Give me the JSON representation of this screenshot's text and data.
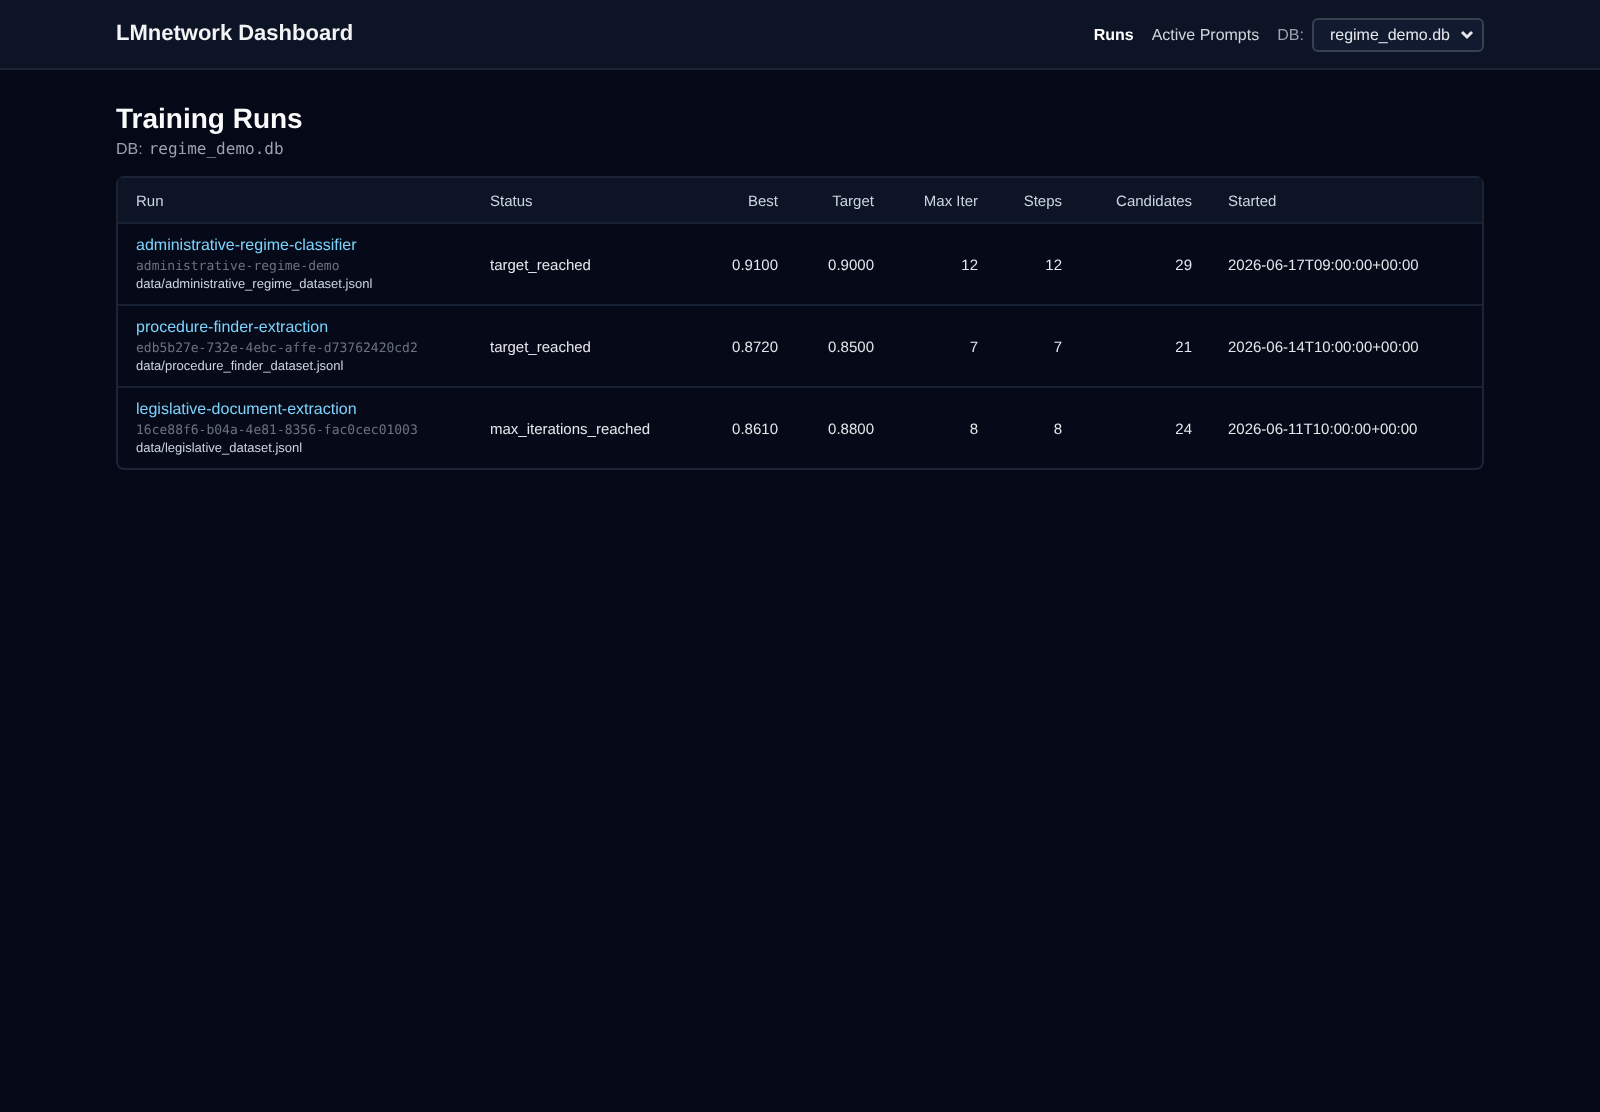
{
  "header": {
    "title": "LMnetwork Dashboard",
    "nav": [
      {
        "label": "Runs",
        "selected": true
      },
      {
        "label": "Active Prompts",
        "selected": false
      }
    ],
    "db_label": "DB:",
    "db_select": "regime_demo.db"
  },
  "page": {
    "title": "Training Runs",
    "db_label": "DB:",
    "db_name": "regime_demo.db"
  },
  "table": {
    "columns": [
      "Run",
      "Status",
      "Best",
      "Target",
      "Max Iter",
      "Steps",
      "Candidates",
      "Started"
    ],
    "rows": [
      {
        "name": "administrative-regime-classifier",
        "id": "administrative-regime-demo",
        "dataset": "data/administrative_regime_dataset.jsonl",
        "status": "target_reached",
        "best": "0.9100",
        "target": "0.9000",
        "max_iter": "12",
        "steps": "12",
        "candidates": "29",
        "started": "2026-06-17T09:00:00+00:00"
      },
      {
        "name": "procedure-finder-extraction",
        "id": "edb5b27e-732e-4ebc-affe-d73762420cd2",
        "dataset": "data/procedure_finder_dataset.jsonl",
        "status": "target_reached",
        "best": "0.8720",
        "target": "0.8500",
        "max_iter": "7",
        "steps": "7",
        "candidates": "21",
        "started": "2026-06-14T10:00:00+00:00"
      },
      {
        "name": "legislative-document-extraction",
        "id": "16ce88f6-b04a-4e81-8356-fac0cec01003",
        "dataset": "data/legislative_dataset.jsonl",
        "status": "max_iterations_reached",
        "best": "0.8610",
        "target": "0.8800",
        "max_iter": "8",
        "steps": "8",
        "candidates": "24",
        "started": "2026-06-11T10:00:00+00:00"
      }
    ]
  }
}
